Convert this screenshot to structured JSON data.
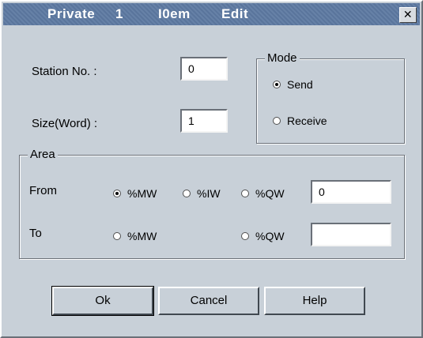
{
  "window": {
    "title_parts": [
      "Private",
      "1",
      "I0em",
      "Edit"
    ],
    "close_glyph": "✕"
  },
  "station": {
    "label": "Station No. :",
    "value": "0"
  },
  "size": {
    "label": "Size(Word) :",
    "value": "1"
  },
  "mode": {
    "title": "Mode",
    "options": [
      {
        "label": "Send",
        "selected": true
      },
      {
        "label": "Receive",
        "selected": false
      }
    ]
  },
  "area": {
    "title": "Area",
    "from": {
      "label": "From",
      "options": [
        {
          "label": "%MW",
          "selected": true
        },
        {
          "label": "%IW",
          "selected": false
        },
        {
          "label": "%QW",
          "selected": false
        }
      ],
      "value": "0"
    },
    "to": {
      "label": "To",
      "options": [
        {
          "label": "%MW",
          "selected": false
        },
        {
          "label": "%QW",
          "selected": false
        }
      ],
      "value": ""
    }
  },
  "buttons": {
    "ok": "Ok",
    "cancel": "Cancel",
    "help": "Help"
  },
  "colors": {
    "titlebar": "#5e7aa2",
    "face": "#c8d0d8"
  }
}
